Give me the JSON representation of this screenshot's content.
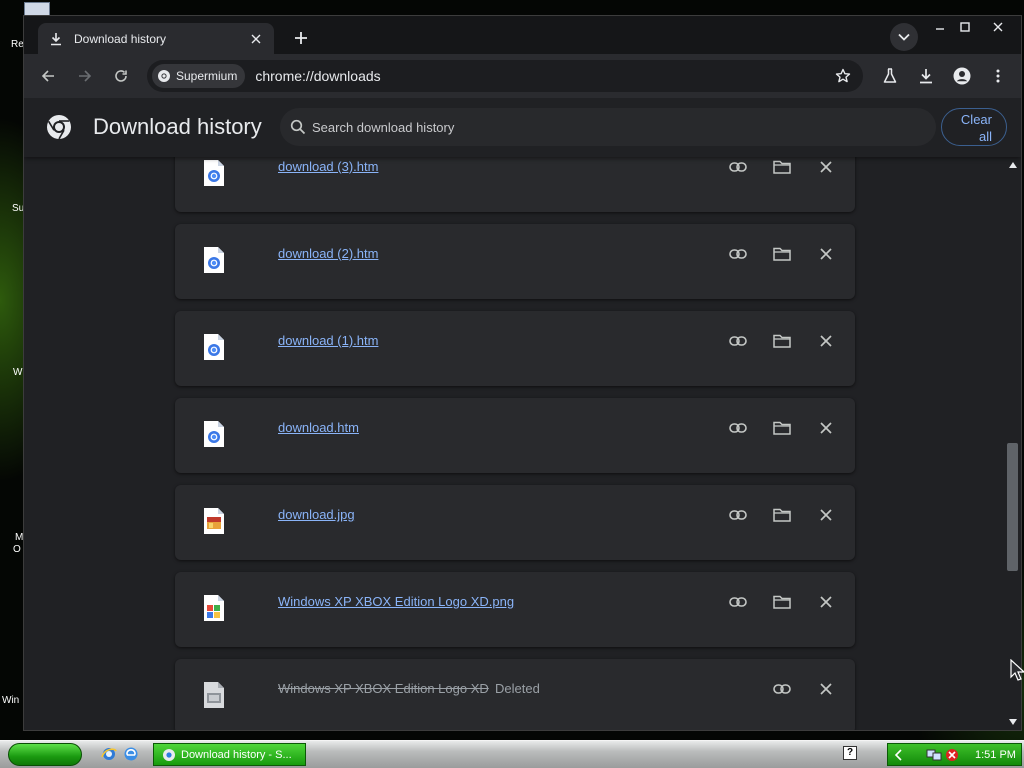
{
  "colors": {
    "accent": "#8ab4f8",
    "page_bg": "#202124",
    "card_bg": "#292a2d",
    "taskbar_green": "#1a9a10"
  },
  "desktop": {
    "fragments": [
      "Re",
      "Su",
      "W",
      "M",
      "O",
      "Win"
    ]
  },
  "tab": {
    "icon": "download-icon",
    "title": "Download history",
    "close_icon": "close-icon"
  },
  "toolbar": {
    "site_chip": "Supermium",
    "url": "chrome://downloads"
  },
  "header": {
    "title": "Download history",
    "search_placeholder": "Search download history",
    "clear_all_line1": "Clear",
    "clear_all_line2": "all"
  },
  "downloads": [
    {
      "name": "download (3).htm",
      "type": "htm",
      "deleted": false,
      "status": ""
    },
    {
      "name": "download (2).htm",
      "type": "htm",
      "deleted": false,
      "status": ""
    },
    {
      "name": "download (1).htm",
      "type": "htm",
      "deleted": false,
      "status": ""
    },
    {
      "name": "download.htm",
      "type": "htm",
      "deleted": false,
      "status": ""
    },
    {
      "name": "download.jpg",
      "type": "jpg",
      "deleted": false,
      "status": ""
    },
    {
      "name": "Windows XP XBOX Edition Logo XD.png",
      "type": "png",
      "deleted": false,
      "status": ""
    },
    {
      "name": "Windows XP XBOX Edition Logo XD",
      "type": "unknown",
      "deleted": true,
      "status": "Deleted"
    }
  ],
  "taskbar": {
    "task_label": "Download history - S...",
    "help": "?",
    "clock": "1:51 PM"
  }
}
